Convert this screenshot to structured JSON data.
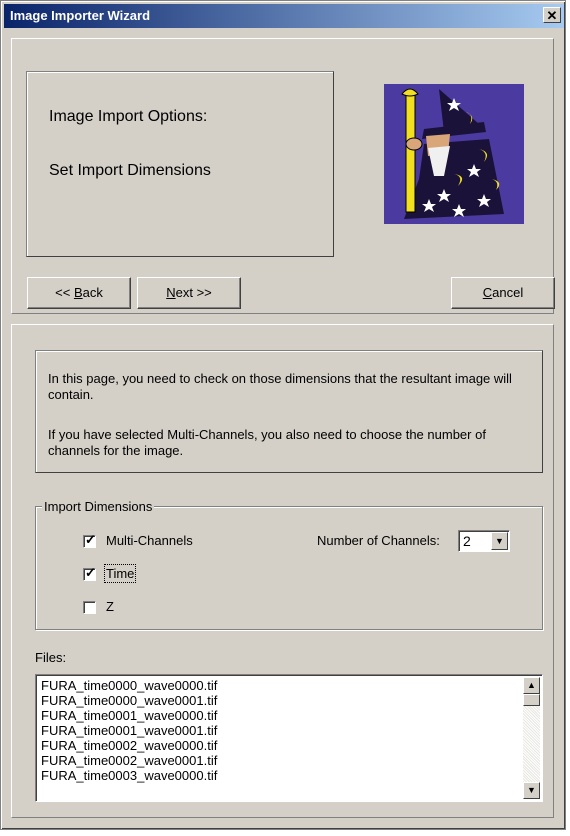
{
  "window": {
    "title": "Image Importer Wizard",
    "close_icon": "close-icon",
    "close_glyph": "✕"
  },
  "header": {
    "line1": "Image Import Options:",
    "line2": "Set Import Dimensions",
    "image": "wizard-illustration"
  },
  "nav": {
    "back_prefix": "<< ",
    "back_hotkey": "B",
    "back_suffix": "ack",
    "next_hotkey": "N",
    "next_suffix": "ext >>",
    "cancel_hotkey": "C",
    "cancel_suffix": "ancel"
  },
  "info": {
    "paragraph1": "In this page, you need to check on those dimensions that the resultant image will contain.",
    "paragraph2": "If you have selected Multi-Channels, you also need to choose the number of channels for the image."
  },
  "dimensions": {
    "group_label": "Import Dimensions",
    "multi_channels": {
      "label": "Multi-Channels",
      "checked": true
    },
    "time": {
      "label": "Time",
      "checked": true
    },
    "z": {
      "label": "Z",
      "checked": false
    },
    "channels_label": "Number of Channels:",
    "channels_value": "2"
  },
  "files": {
    "label": "Files:",
    "items": [
      "FURA_time0000_wave0000.tif",
      "FURA_time0000_wave0001.tif",
      "FURA_time0001_wave0000.tif",
      "FURA_time0001_wave0001.tif",
      "FURA_time0002_wave0000.tif",
      "FURA_time0002_wave0001.tif",
      "FURA_time0003_wave0000.tif"
    ]
  },
  "colors": {
    "face": "#d4d0c8",
    "title_start": "#0a246a",
    "title_end": "#a6caf0",
    "wizard_bg": "#4b3aa0"
  }
}
